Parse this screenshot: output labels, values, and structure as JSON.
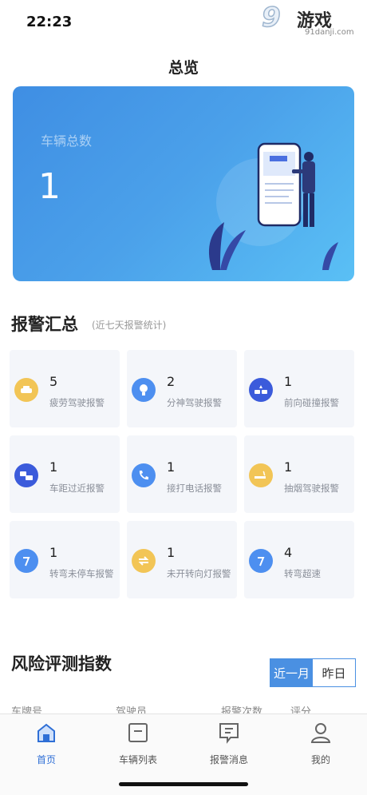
{
  "status_bar": {
    "time": "22:23"
  },
  "watermark": {
    "big": "9",
    "game": "游戏",
    "url": "91danji.com"
  },
  "page": {
    "title": "总览"
  },
  "hero": {
    "label": "车辆总数",
    "value": "1"
  },
  "alerts": {
    "title": "报警汇总",
    "subtitle": "(近七天报警统计)",
    "items": [
      {
        "count": "5",
        "label": "疲劳驾驶报警",
        "icon": "fatigue-car-icon",
        "color": "#f2c556"
      },
      {
        "count": "2",
        "label": "分神驾驶报警",
        "icon": "distraction-icon",
        "color": "#4d8ff0"
      },
      {
        "count": "1",
        "label": "前向碰撞报警",
        "icon": "collision-icon",
        "color": "#3b5bdb"
      },
      {
        "count": "1",
        "label": "车距过近报警",
        "icon": "distance-icon",
        "color": "#3b5bdb"
      },
      {
        "count": "1",
        "label": "接打电话报警",
        "icon": "phone-icon",
        "color": "#4d8ff0"
      },
      {
        "count": "1",
        "label": "抽烟驾驶报警",
        "icon": "smoking-icon",
        "color": "#f2c556"
      },
      {
        "count": "1",
        "label": "转弯未停车报警",
        "icon": "turn-icon",
        "color": "#4d8ff0"
      },
      {
        "count": "1",
        "label": "未开转向灯报警",
        "icon": "turn-signal-icon",
        "color": "#f2c556"
      },
      {
        "count": "4",
        "label": "转弯超速",
        "icon": "turn-speed-icon",
        "color": "#4d8ff0"
      }
    ]
  },
  "risk": {
    "title": "风险评测指数",
    "tabs": [
      {
        "label": "近一月",
        "active": true
      },
      {
        "label": "昨日",
        "active": false
      }
    ],
    "partial_headers": [
      "车牌号",
      "驾驶员",
      "报警次数",
      "评分"
    ]
  },
  "tabbar": {
    "items": [
      {
        "label": "首页",
        "icon": "home-icon",
        "active": true
      },
      {
        "label": "车辆列表",
        "icon": "vehicle-list-icon",
        "active": false
      },
      {
        "label": "报警消息",
        "icon": "alert-message-icon",
        "active": false
      },
      {
        "label": "我的",
        "icon": "profile-icon",
        "active": false
      }
    ]
  },
  "colors": {
    "accent": "#4a90e2",
    "hero_start": "#3f8ee3",
    "hero_end": "#5ac0f5"
  }
}
